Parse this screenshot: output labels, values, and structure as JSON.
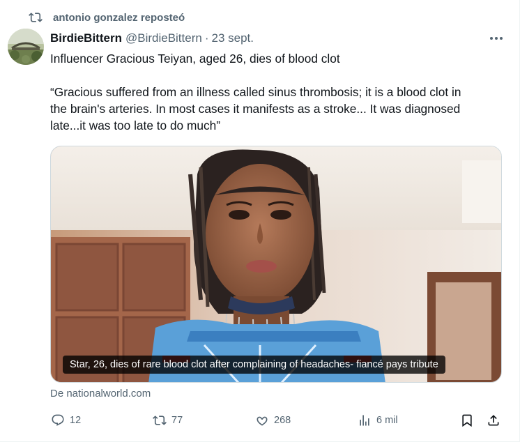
{
  "repost": {
    "text": "antonio gonzalez reposteó",
    "icon": "repost-icon"
  },
  "author": {
    "display_name": "BirdieBittern",
    "handle": "@BirdieBittern",
    "separator": "·",
    "date": "23 sept.",
    "avatar": "avatar-bridge-landscape"
  },
  "tweet": {
    "line1": "Influencer Gracious Teiyan, aged 26, dies of blood clot",
    "quote_lines": [
      "“Gracious suffered from an illness called sinus thrombosis; it is a blood clot in",
      "the brain's arteries. In most cases it manifests as a stroke... It was diagnosed",
      "late...it was too late to do much”"
    ]
  },
  "media": {
    "caption": "Star, 26, dies of rare blood clot after complaining of headaches- fiancé pays tribute"
  },
  "source": "De nationalworld.com",
  "actions": {
    "replies": "12",
    "reposts": "77",
    "likes": "268",
    "views": "6 mil"
  },
  "colors": {
    "text": "#0f1419",
    "muted": "#536471",
    "border": "#cfd9de"
  }
}
